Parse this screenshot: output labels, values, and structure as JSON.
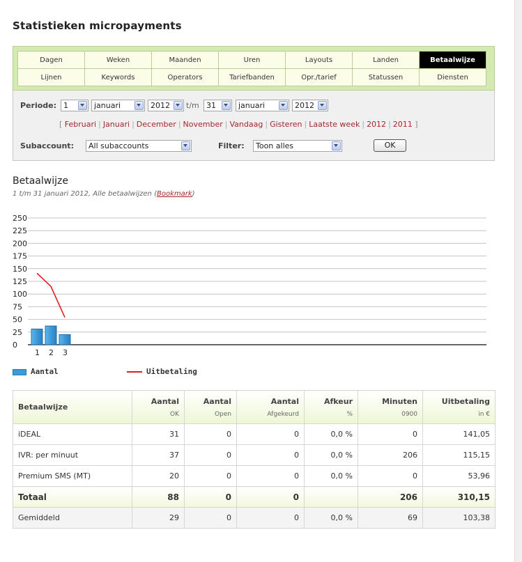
{
  "page": {
    "title": "Statistieken micropayments"
  },
  "nav": {
    "row1": [
      "Dagen",
      "Weken",
      "Maanden",
      "Uren",
      "Layouts",
      "Landen",
      "Betaalwijze"
    ],
    "row2": [
      "Lijnen",
      "Keywords",
      "Operators",
      "Tariefbanden",
      "Opr./tarief",
      "Statussen",
      "Diensten"
    ],
    "active": "Betaalwijze"
  },
  "filters": {
    "periode_label": "Periode:",
    "from_day": "1",
    "from_month": "januari",
    "from_year": "2012",
    "tm": "t/m",
    "to_day": "31",
    "to_month": "januari",
    "to_year": "2012",
    "quick_links": [
      "Februari",
      "Januari",
      "December",
      "November",
      "Vandaag",
      "Gisteren",
      "Laatste week",
      "2012",
      "2011"
    ],
    "bracket_open": "[",
    "bracket_close": "]",
    "subaccount_label": "Subaccount:",
    "subaccount_value": "All subaccounts",
    "filter_label": "Filter:",
    "filter_value": "Toon alles",
    "ok_label": "OK"
  },
  "section": {
    "title": "Betaalwijze",
    "subtitle": "1 t/m 31 januari 2012, Alle betaalwijzen",
    "bookmark": "Bookmark"
  },
  "chart_data": {
    "type": "bar",
    "categories": [
      "1",
      "2",
      "3"
    ],
    "ylim": [
      0,
      250
    ],
    "yticks": [
      0,
      25,
      50,
      75,
      100,
      125,
      150,
      175,
      200,
      225,
      250
    ],
    "grid": true,
    "legend_position": "bottom-left",
    "series": [
      {
        "name": "Aantal",
        "type": "bar",
        "values": [
          31,
          37,
          20
        ],
        "color": "#3d9ad8"
      },
      {
        "name": "Uitbetaling",
        "type": "line",
        "values": [
          141.05,
          115.15,
          53.96
        ],
        "color": "#e31b1b"
      }
    ]
  },
  "table": {
    "headers": [
      {
        "label": "Betaalwijze",
        "sub": ""
      },
      {
        "label": "Aantal",
        "sub": "OK"
      },
      {
        "label": "Aantal",
        "sub": "Open"
      },
      {
        "label": "Aantal",
        "sub": "Afgekeurd"
      },
      {
        "label": "Afkeur",
        "sub": "%"
      },
      {
        "label": "Minuten",
        "sub": "0900"
      },
      {
        "label": "Uitbetaling",
        "sub": "in €"
      }
    ],
    "rows": [
      [
        "iDEAL",
        "31",
        "0",
        "0",
        "0,0 %",
        "0",
        "141,05"
      ],
      [
        "IVR: per minuut",
        "37",
        "0",
        "0",
        "0,0 %",
        "206",
        "115,15"
      ],
      [
        "Premium SMS (MT)",
        "20",
        "0",
        "0",
        "0,0 %",
        "0",
        "53,96"
      ]
    ],
    "total": [
      "Totaal",
      "88",
      "0",
      "0",
      "",
      "206",
      "310,15"
    ],
    "average": [
      "Gemiddeld",
      "29",
      "0",
      "0",
      "0,0 %",
      "69",
      "103,38"
    ]
  }
}
